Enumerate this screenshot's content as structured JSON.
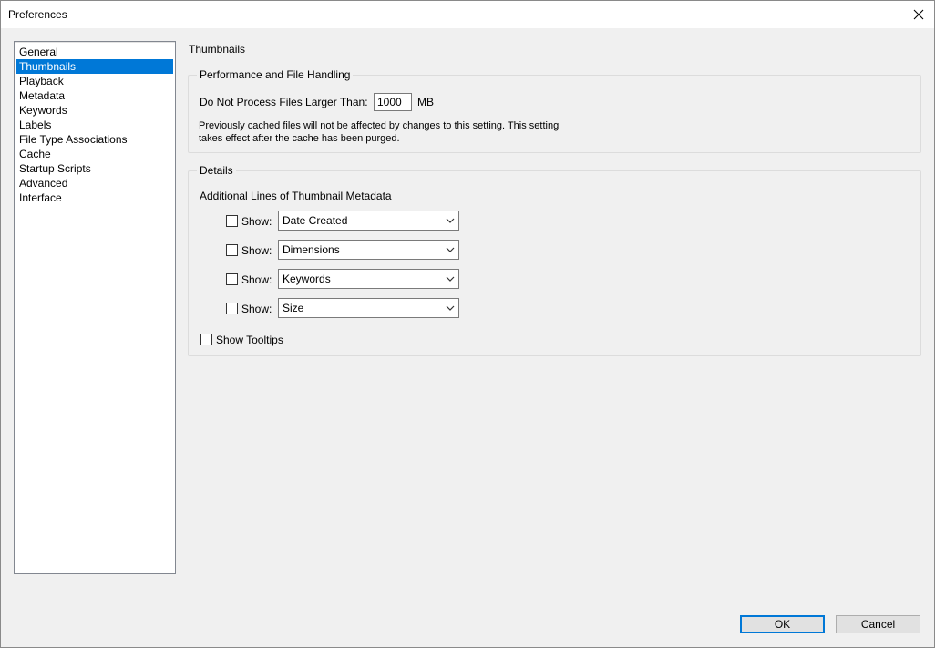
{
  "window": {
    "title": "Preferences"
  },
  "sidebar": {
    "items": [
      {
        "label": "General",
        "selected": false
      },
      {
        "label": "Thumbnails",
        "selected": true
      },
      {
        "label": "Playback",
        "selected": false
      },
      {
        "label": "Metadata",
        "selected": false
      },
      {
        "label": "Keywords",
        "selected": false
      },
      {
        "label": "Labels",
        "selected": false
      },
      {
        "label": "File Type Associations",
        "selected": false
      },
      {
        "label": "Cache",
        "selected": false
      },
      {
        "label": "Startup Scripts",
        "selected": false
      },
      {
        "label": "Advanced",
        "selected": false
      },
      {
        "label": "Interface",
        "selected": false
      }
    ]
  },
  "panel": {
    "title": "Thumbnails",
    "performance": {
      "legend": "Performance and File Handling",
      "limit_label": "Do Not Process Files Larger Than:",
      "limit_value": "1000",
      "limit_unit": "MB",
      "note_line1": "Previously cached files will not be affected by changes to this setting. This setting",
      "note_line2": "takes effect after the cache has been purged."
    },
    "details": {
      "legend": "Details",
      "metadata_label": "Additional Lines of Thumbnail Metadata",
      "rows": [
        {
          "show_label": "Show:",
          "value": "Date Created",
          "checked": false
        },
        {
          "show_label": "Show:",
          "value": "Dimensions",
          "checked": false
        },
        {
          "show_label": "Show:",
          "value": "Keywords",
          "checked": false
        },
        {
          "show_label": "Show:",
          "value": "Size",
          "checked": false
        }
      ],
      "tooltips_label": "Show Tooltips",
      "tooltips_checked": false
    }
  },
  "buttons": {
    "ok": "OK",
    "cancel": "Cancel"
  },
  "colors": {
    "selection": "#0078d7",
    "dialog_bg": "#f0f0f0"
  }
}
